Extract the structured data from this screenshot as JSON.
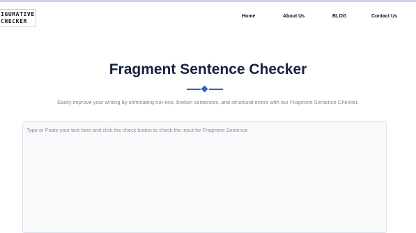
{
  "colors": {
    "accent": "#2d62c8",
    "title": "#16213d",
    "subtitle": "#7d8697",
    "top_bar": "#c9d3ee"
  },
  "logo": {
    "line1": "IGURATIVE",
    "line2": "CHECKER"
  },
  "nav": {
    "home": "Home",
    "about": "About Us",
    "blog": "BLOG",
    "contact": "Contact Us"
  },
  "main": {
    "title": "Fragment Sentence Checker",
    "subtitle": "Easily improve your writing by eliminating run-ons, broken sentences, and structural errors with our Fragment Sentence Checker.",
    "input_value": "",
    "input_placeholder": "Type or Paste your text here and click the check button to check the input for Fragment Sentence"
  }
}
